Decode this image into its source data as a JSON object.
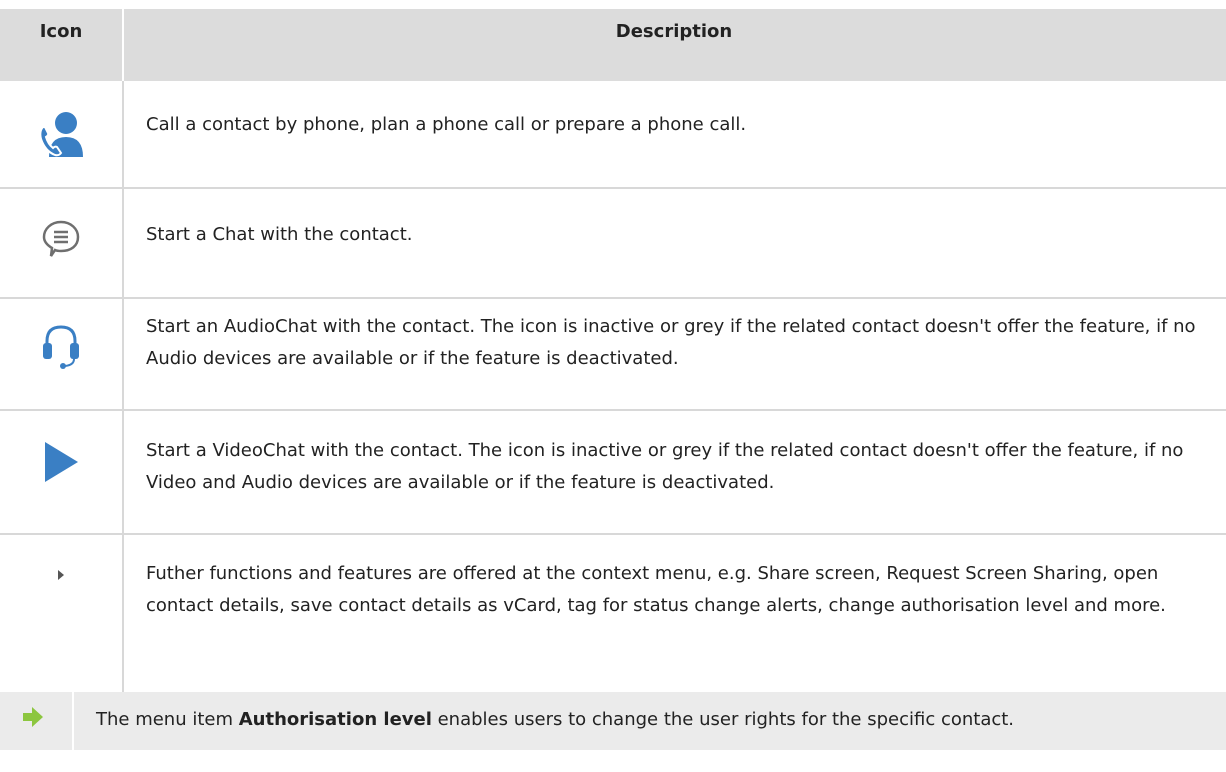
{
  "table": {
    "headers": {
      "icon": "Icon",
      "description": "Description"
    },
    "rows": [
      {
        "icon": "phone-contact-icon",
        "description": "Call a contact by phone, plan a phone call or prepare a phone call."
      },
      {
        "icon": "chat-bubble-icon",
        "description": "Start a Chat with the contact."
      },
      {
        "icon": "headset-icon",
        "description": "Start an AudioChat with the contact. The icon is inactive or grey if the related contact doesn't offer the feature, if no Audio devices are available or if the feature is deactivated."
      },
      {
        "icon": "video-play-icon",
        "description": "Start a VideoChat with the contact. The icon is inactive or grey if the related contact doesn't offer the feature, if no Video and Audio devices are available or if the feature is deactivated."
      },
      {
        "icon": "context-menu-arrow-icon",
        "description": "Futher functions and features are offered at the context menu, e.g. Share screen, Request Screen Sharing, open contact details, save contact details as vCard, tag for status change alerts, change authorisation level and more."
      }
    ]
  },
  "note": {
    "icon": "green-arrow-right-icon",
    "prefix": "The menu item ",
    "bold": "Authorisation level",
    "suffix": " enables users to change the user rights for the specific contact."
  },
  "colors": {
    "icon_blue": "#3a7fc4",
    "header_bg": "#dcdcdc",
    "note_bg": "#ebebeb",
    "note_arrow": "#8cc63f"
  }
}
